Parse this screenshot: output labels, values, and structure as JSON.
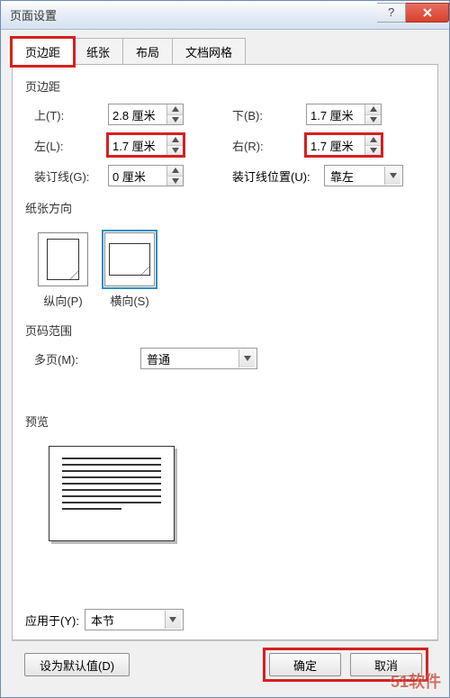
{
  "window": {
    "title": "页面设置"
  },
  "tabs": {
    "margins": "页边距",
    "paper": "纸张",
    "layout": "布局",
    "grid": "文档网格"
  },
  "groups": {
    "margins": "页边距",
    "orientation": "纸张方向",
    "pages": "页码范围",
    "preview": "预览"
  },
  "margins": {
    "top_label": "上(T):",
    "top_value": "2.8 厘米",
    "bottom_label": "下(B):",
    "bottom_value": "1.7 厘米",
    "left_label": "左(L):",
    "left_value": "1.7 厘米",
    "right_label": "右(R):",
    "right_value": "1.7 厘米",
    "gutter_label": "装订线(G):",
    "gutter_value": "0 厘米",
    "gutter_pos_label": "装订线位置(U):",
    "gutter_pos_value": "靠左"
  },
  "orientation": {
    "portrait": "纵向(P)",
    "landscape": "横向(S)"
  },
  "pages": {
    "multi_label": "多页(M):",
    "multi_value": "普通"
  },
  "apply": {
    "label": "应用于(Y):",
    "value": "本节"
  },
  "buttons": {
    "default": "设为默认值(D)",
    "ok": "确定",
    "cancel": "取消"
  },
  "watermark": "51软件"
}
